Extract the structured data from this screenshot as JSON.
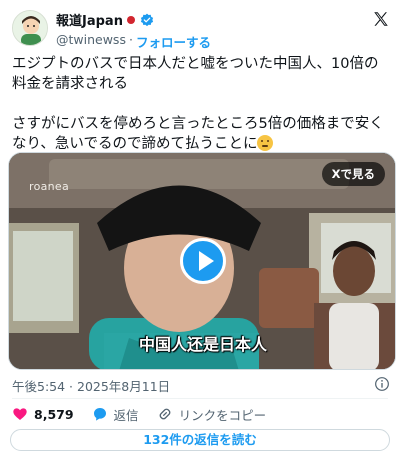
{
  "header": {
    "display_name": "報道Japan",
    "handle": "@twinewss",
    "separator": "·",
    "follow_label": "フォローする",
    "verified_color": "#1d9bf0"
  },
  "tweet": {
    "line1": "エジプトのバスで日本人だと嘘をついた中国人、10倍の料金を請求される",
    "line2": "さすがにバスを停めろと言ったところ5倍の価格まで安くなり、急いでるので諦めて払うことに",
    "emoji": "thinking-face"
  },
  "media": {
    "watermark": "roanea",
    "view_on_x_label": "Xで見る",
    "subtitle": "中国人还是日本人"
  },
  "meta": {
    "timestamp": "午後5:54 · 2025年8月11日"
  },
  "actions": {
    "like_count": "8,579",
    "reply_label": "返信",
    "copy_link_label": "リンクをコピー"
  },
  "replies_button": {
    "label": "132件の返信を読む"
  },
  "colors": {
    "accent": "#1d9bf0",
    "like": "#f91880",
    "text": "#0f1419",
    "muted": "#536471"
  }
}
